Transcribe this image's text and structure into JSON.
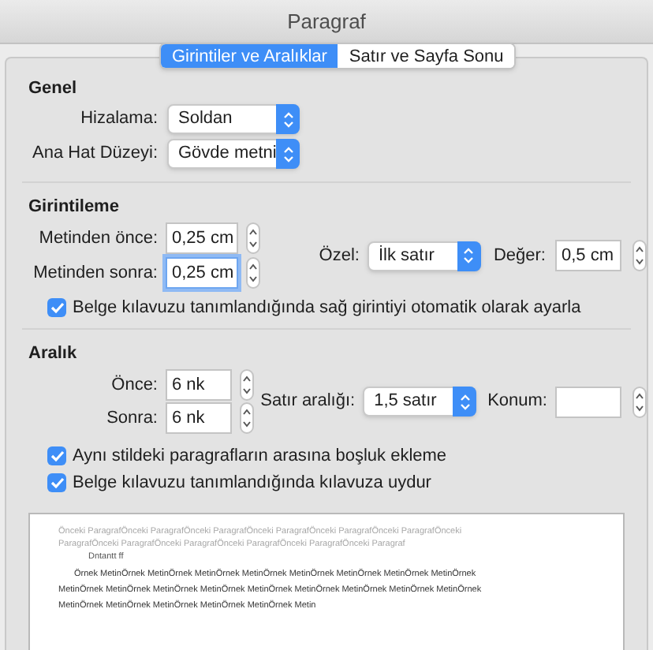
{
  "window": {
    "title": "Paragraf"
  },
  "tabs": [
    {
      "label": "Girintiler ve Aralıklar",
      "selected": true
    },
    {
      "label": "Satır ve Sayfa Sonu",
      "selected": false
    }
  ],
  "general": {
    "heading": "Genel",
    "rows": [
      {
        "label": "Hizalama:",
        "value": "Soldan"
      },
      {
        "label": "Ana Hat Düzeyi:",
        "value": "Gövde metni"
      }
    ]
  },
  "indentation": {
    "heading": "Girintileme",
    "fields": [
      {
        "label": "Metinden önce:",
        "value": "0,25 cm",
        "focused": false
      },
      {
        "label": "Metinden sonra:",
        "value": "0,25 cm",
        "focused": true
      }
    ],
    "special": {
      "label": "Özel:",
      "value": "İlk satır"
    },
    "by": {
      "label": "Değer:",
      "value": "0,5 cm"
    },
    "options": [
      {
        "label": "Belge kılavuzu tanımlandığında sağ girintiyi otomatik olarak ayarla",
        "checked": true
      }
    ]
  },
  "spacing": {
    "heading": "Aralık",
    "fields": [
      {
        "label": "Önce:",
        "value": "6 nk",
        "focused": false
      },
      {
        "label": "Sonra:",
        "value": "6 nk",
        "focused": false
      }
    ],
    "line_spacing": {
      "label": "Satır aralığı:",
      "value": "1,5 satır"
    },
    "at": {
      "label": "Konum:"
    },
    "options": [
      {
        "label": "Aynı stildeki paragrafların arasına boşluk ekleme",
        "checked": true
      },
      {
        "label": "Belge kılavuzu tanımlandığında kılavuza uydur",
        "checked": true
      }
    ]
  },
  "preview": {
    "previous_lines": [
      "Önceki ParagrafÖnceki ParagrafÖnceki ParagrafÖnceki ParagrafÖnceki ParagrafÖnceki ParagrafÖnceki",
      "ParagrafÖnceki ParagrafÖnceki ParagrafÖnceki ParagrafÖnceki ParagrafÖnceki Paragraf"
    ],
    "marker": "Dntantt ff",
    "sample_lines": [
      "Örnek MetinÖrnek MetinÖrnek MetinÖrnek MetinÖrnek MetinÖrnek MetinÖrnek MetinÖrnek MetinÖrnek",
      "MetinÖrnek MetinÖrnek MetinÖrnek MetinÖrnek MetinÖrnek MetinÖrnek MetinÖrnek MetinÖrnek MetinÖrnek",
      "MetinÖrnek MetinÖrnek MetinÖrnek MetinÖrnek MetinÖrnek Metin"
    ]
  }
}
